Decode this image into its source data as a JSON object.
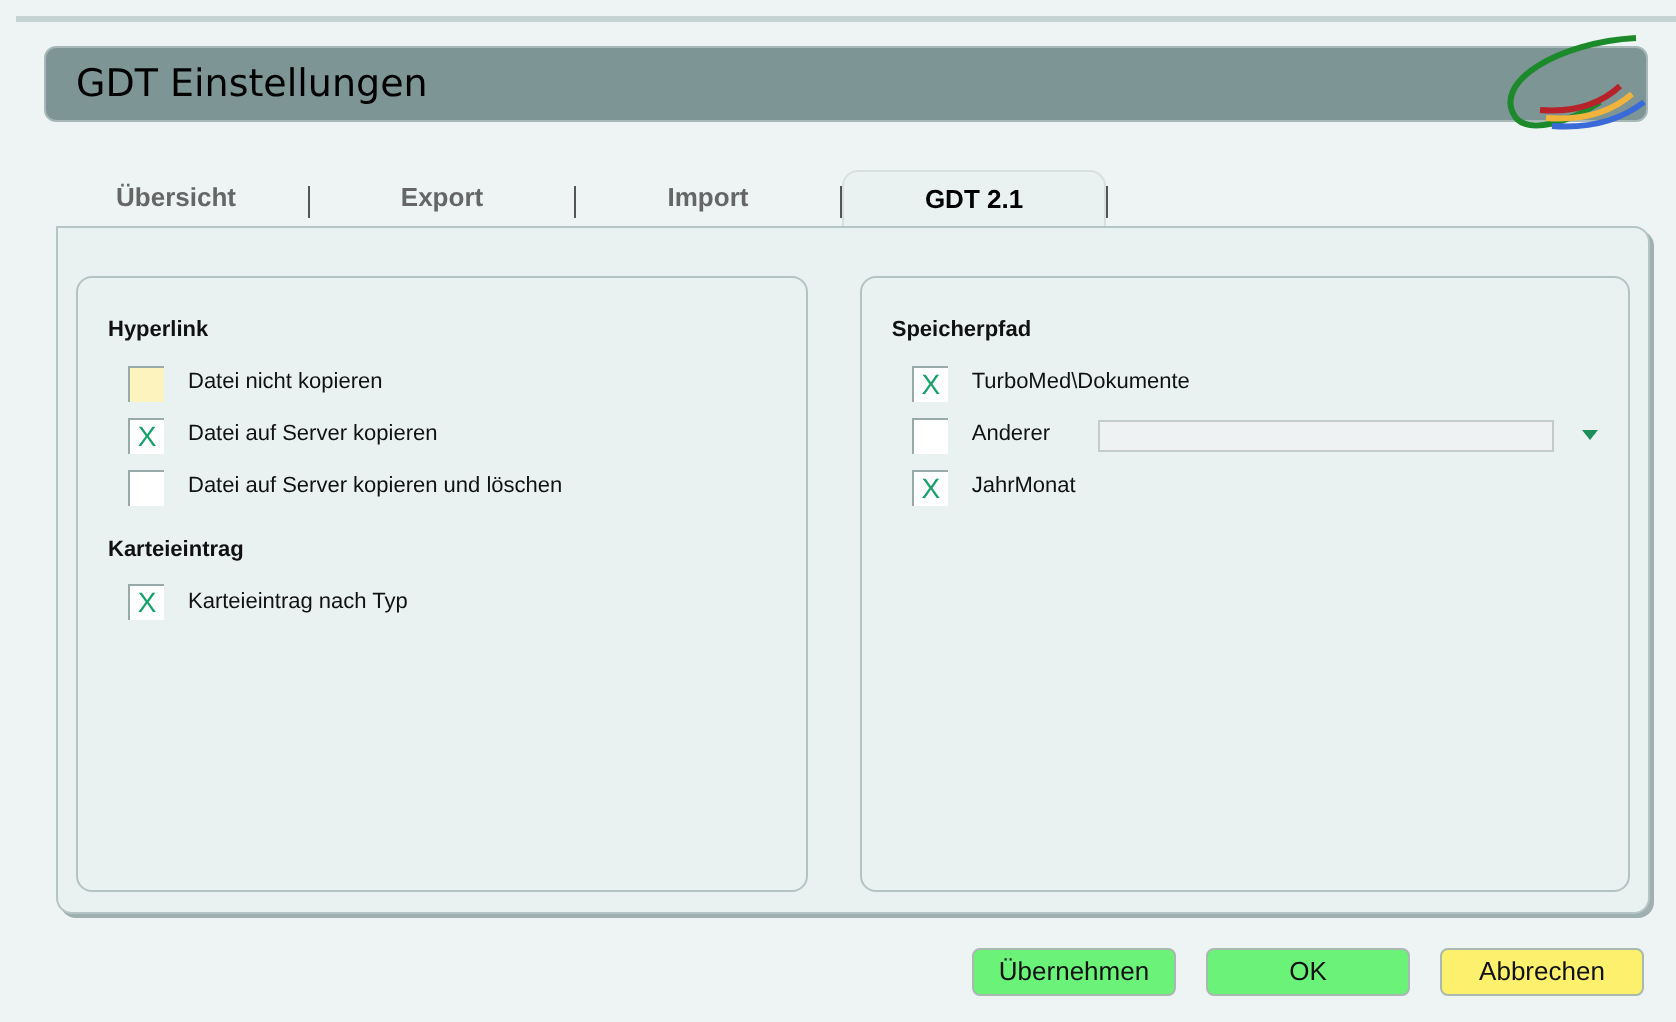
{
  "window": {
    "title": "GDT Einstellungen"
  },
  "tabs": [
    {
      "label": "Übersicht",
      "selected": false
    },
    {
      "label": "Export",
      "selected": false
    },
    {
      "label": "Import",
      "selected": false
    },
    {
      "label": "GDT 2.1",
      "selected": true
    }
  ],
  "groups": [
    {
      "sections": [
        {
          "title": "Hyperlink",
          "items": [
            {
              "label": "Datei nicht kopieren",
              "focused": true
            },
            {
              "label": "Datei auf Server kopieren",
              "mark": "X",
              "focused": false
            },
            {
              "label": "Datei auf Server kopieren und löschen",
              "focused": false
            }
          ]
        },
        {
          "title": "Karteieintrag",
          "items": [
            {
              "label": "Karteieintrag nach Typ",
              "mark": "X",
              "focused": false
            }
          ]
        }
      ]
    },
    {
      "sections": [
        {
          "title": "Speicherpfad",
          "items": [
            {
              "label": "TurboMed\\Dokumente",
              "mark": "X",
              "focused": false
            },
            {
              "label": "Anderer",
              "focused": false,
              "kind": "combo"
            },
            {
              "label": "JahrMonat",
              "mark": "X",
              "focused": false
            }
          ]
        }
      ]
    }
  ],
  "buttons": [
    {
      "label": "Übernehmen",
      "kind": "green"
    },
    {
      "label": "OK",
      "kind": "green"
    },
    {
      "label": "Abbrechen",
      "kind": "yellow"
    }
  ]
}
